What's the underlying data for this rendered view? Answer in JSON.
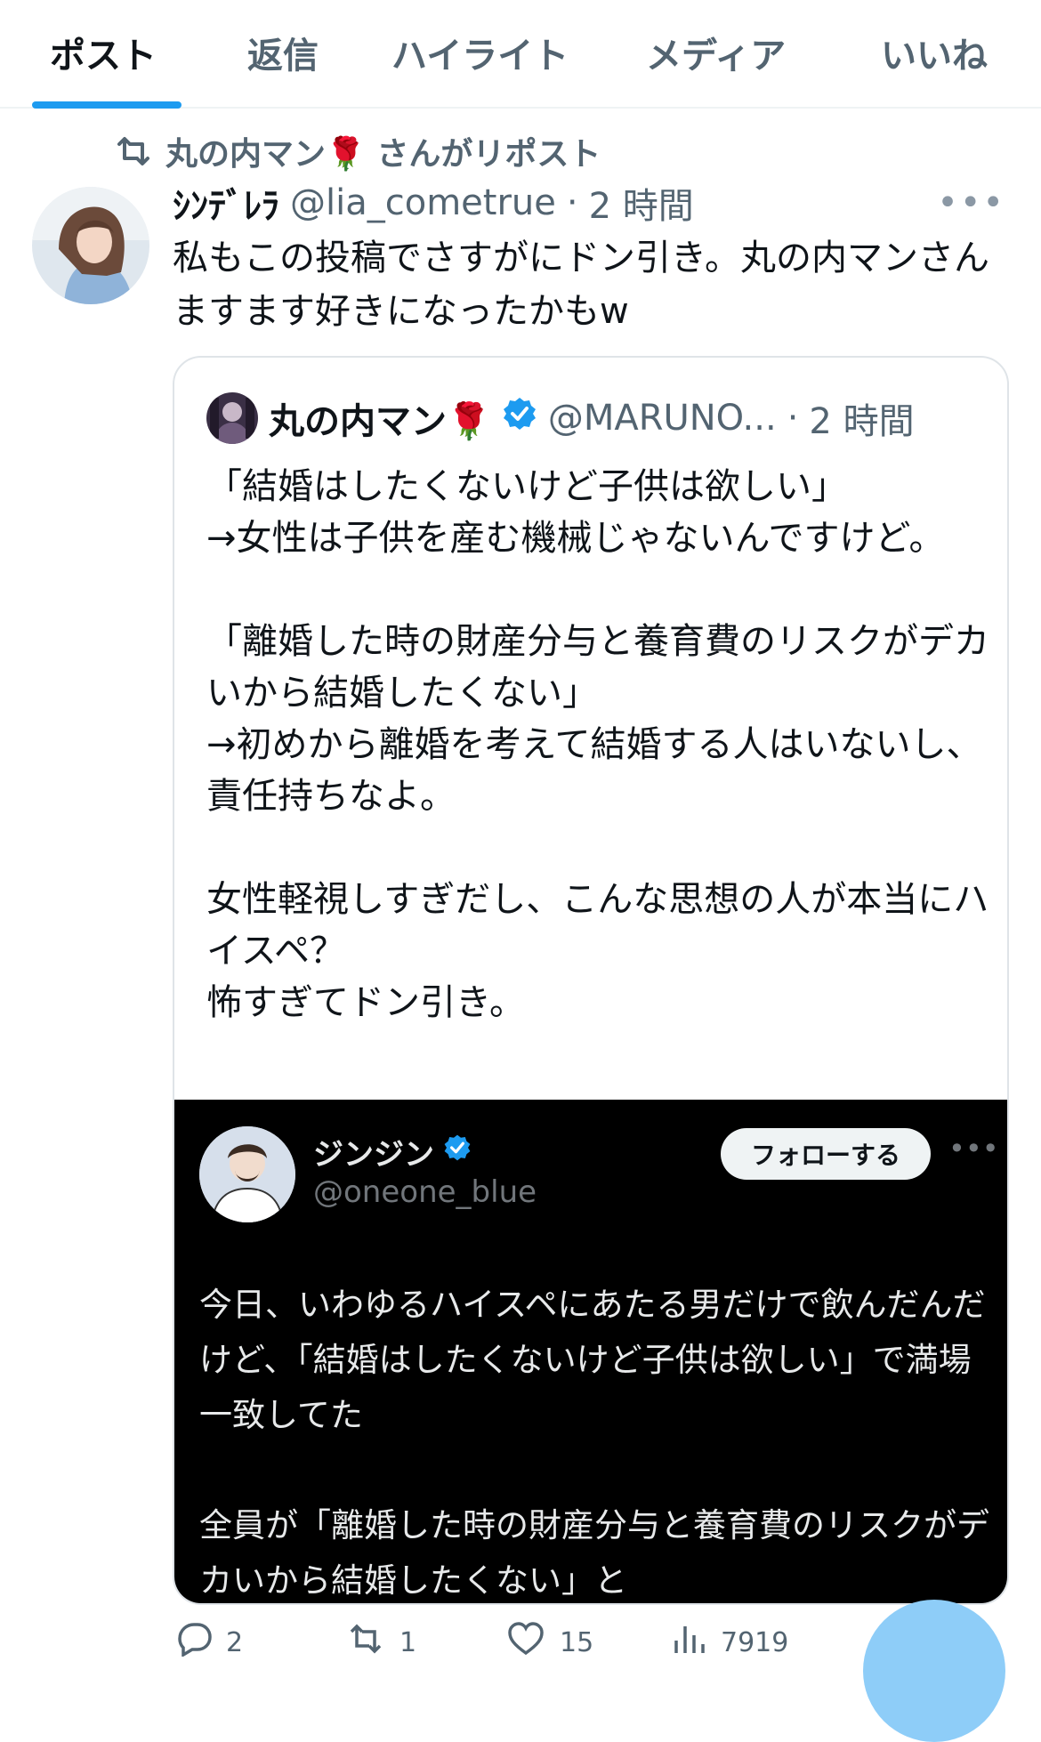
{
  "tabs": [
    {
      "label": "ポスト",
      "active": true
    },
    {
      "label": "返信",
      "active": false
    },
    {
      "label": "ハイライト",
      "active": false
    },
    {
      "label": "メディア",
      "active": false
    },
    {
      "label": "いいね",
      "active": false
    }
  ],
  "repost": {
    "icon": "retweet-icon",
    "text": "丸の内マン🌹 さんがリポスト"
  },
  "tweet": {
    "display_name": "ｼﾝﾃﾞﾚﾗ",
    "handle": "@lia_cometrue",
    "separator": "·",
    "time": "2 時間",
    "more": "•••",
    "text": "私もこの投稿でさすがにドン引き。丸の内マンさんますます好きになったかもw"
  },
  "quote": {
    "display_name": "丸の内マン🌹",
    "verified_icon": "verified-badge-icon",
    "handle": "@MARUNO...",
    "separator": "·",
    "time": "2 時間",
    "text": "「結婚はしたくないけど子供は欲しい」\n→女性は子供を産む機械じゃないんですけど。\n\n「離婚した時の財産分与と養育費のリスクがデカいから結婚したくない」\n→初めから離婚を考えて結婚する人はいないし、責任持ちなよ。\n\n女性軽視しすぎだし、こんな思想の人が本当にハイスペ？\n怖すぎてドン引き。"
  },
  "embedded": {
    "display_name": "ジンジン",
    "verified_icon": "verified-badge-icon",
    "handle": "@oneone_blue",
    "follow_label": "フォローする",
    "more": "•••",
    "text": "今日、いわゆるハイスペにあたる男だけで飲んだんだけど、「結婚はしたくないけど子供は欲しい」で満場一致してた\n\n全員が「離婚した時の財産分与と養育費のリスクがデカいから結婚したくない」と"
  },
  "actions": [
    {
      "icon": "reply-icon",
      "count": "2"
    },
    {
      "icon": "retweet-icon",
      "count": "1"
    },
    {
      "icon": "heart-icon",
      "count": "15"
    },
    {
      "icon": "views-icon",
      "count": "7919"
    }
  ],
  "colors": {
    "accent": "#1d9bf0",
    "secondary_text": "#536471",
    "fab": "#8ecdf8"
  }
}
